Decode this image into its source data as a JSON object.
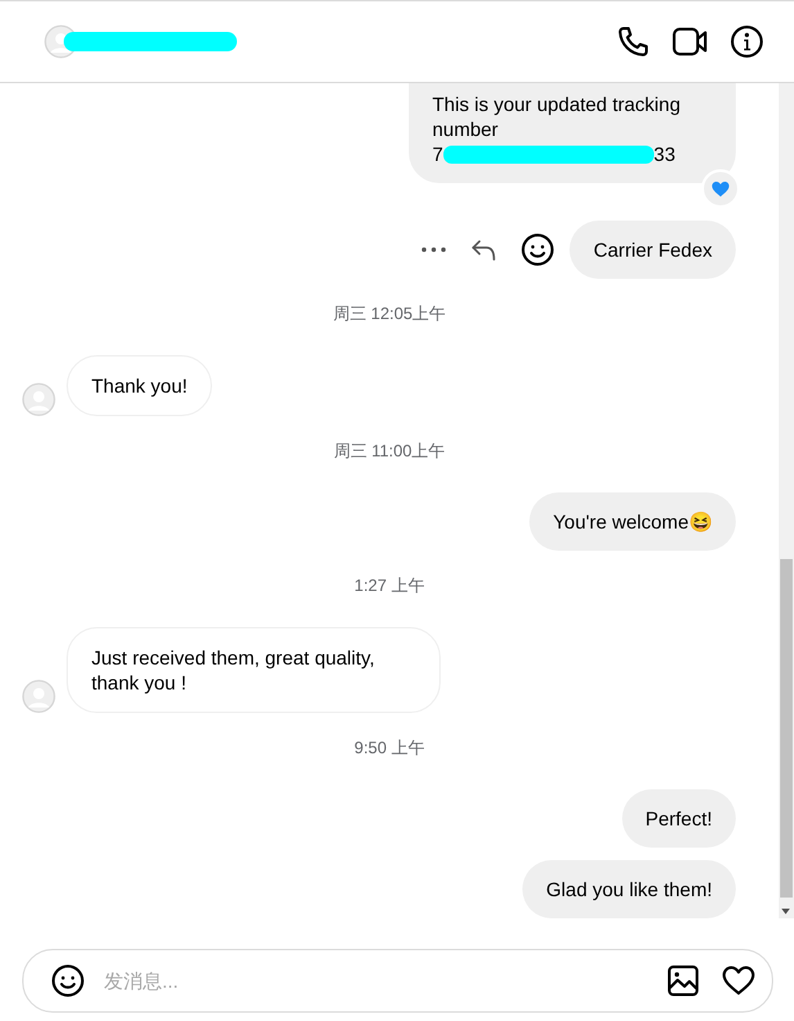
{
  "header": {
    "name_redacted": true
  },
  "messages": [
    {
      "kind": "outgoing",
      "lines": [
        "This is your updated tracking number"
      ],
      "tracking_start": "7",
      "tracking_end": "33",
      "redacted": true,
      "reaction": true
    },
    {
      "kind": "outgoing",
      "lines": [
        "Carrier Fedex"
      ],
      "hover_actions": true
    },
    {
      "kind": "timestamp",
      "text": "周三 12:05上午"
    },
    {
      "kind": "incoming",
      "lines": [
        "Thank you!"
      ]
    },
    {
      "kind": "timestamp",
      "text": "周三 11:00上午"
    },
    {
      "kind": "outgoing",
      "lines": [
        "You're welcome😆"
      ]
    },
    {
      "kind": "timestamp",
      "text": "1:27 上午"
    },
    {
      "kind": "incoming",
      "lines": [
        "Just received them, great quality, thank you !"
      ]
    },
    {
      "kind": "timestamp",
      "text": "9:50 上午"
    },
    {
      "kind": "outgoing",
      "lines": [
        "Perfect!"
      ]
    },
    {
      "kind": "outgoing",
      "lines": [
        "Glad you like them!"
      ]
    }
  ],
  "composer": {
    "placeholder": "发消息..."
  }
}
